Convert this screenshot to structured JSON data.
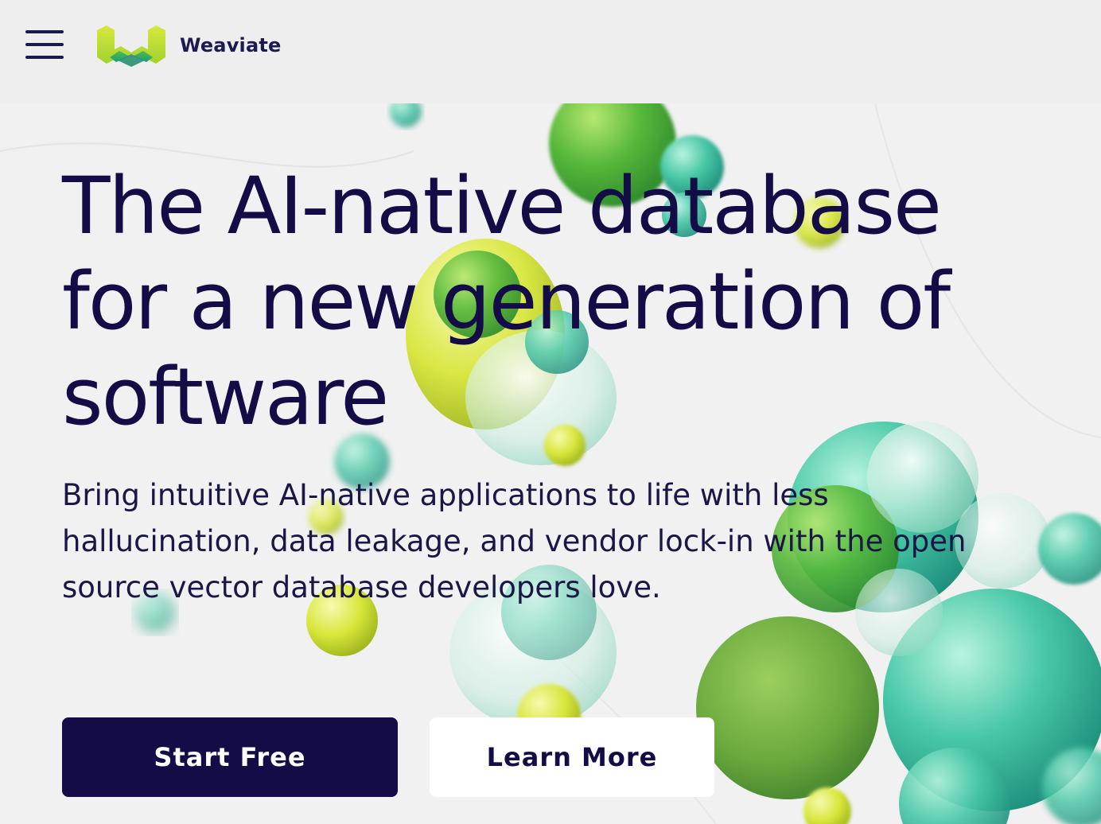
{
  "header": {
    "menu_icon": "hamburger-menu-icon",
    "logo_icon": "weaviate-logo-icon",
    "brand_name": "Weaviate"
  },
  "hero": {
    "headline": "The AI-native database for a new generation of software",
    "subtitle": "Bring intuitive AI-native applications to life with less hallucination, data leakage, and vendor lock-in with the open source vector database developers love.",
    "primary_button": "Start Free",
    "secondary_button": "Learn More"
  },
  "colors": {
    "brand_dark": "#130c47",
    "header_bg": "#eeeeee",
    "page_bg": "#f1f1f1",
    "logo_yellow": "#c8e02a",
    "logo_green": "#3fb54a",
    "sphere_teal": "#3cc4a0",
    "sphere_green": "#5fb83a",
    "sphere_yellow": "#d8e63a"
  }
}
